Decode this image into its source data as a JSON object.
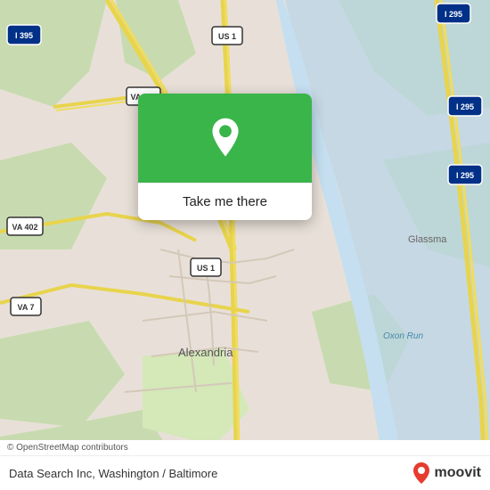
{
  "map": {
    "attribution": "© OpenStreetMap contributors",
    "location_label": "Data Search Inc, Washington / Baltimore",
    "moovit_label": "moovit",
    "popup": {
      "button_label": "Take me there"
    }
  }
}
